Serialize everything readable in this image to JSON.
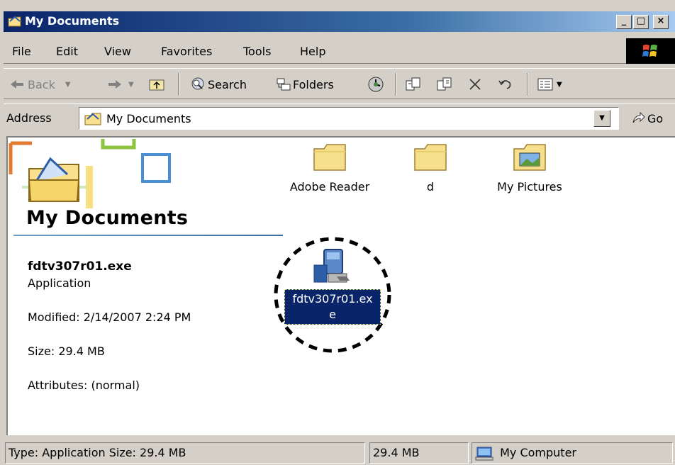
{
  "window": {
    "title": "My Documents",
    "minimize": "_",
    "maximize": "□",
    "close": "×"
  },
  "menu": [
    "File",
    "Edit",
    "View",
    "Favorites",
    "Tools",
    "Help"
  ],
  "toolbar": {
    "back": "Back",
    "search": "Search",
    "folders": "Folders"
  },
  "address": {
    "label": "Address",
    "value": "My Documents",
    "go": "Go"
  },
  "panel": {
    "title": "My Documents",
    "file_name": "fdtv307r01.exe",
    "file_type": "Application",
    "modified": "Modified: 2/14/2007 2:24 PM",
    "size": "Size: 29.4 MB",
    "attributes": "Attributes: (normal)"
  },
  "items": [
    {
      "label": "Adobe Reader",
      "icon": "folder-icon"
    },
    {
      "label": "d",
      "icon": "folder-icon"
    },
    {
      "label": "My Pictures",
      "icon": "pictures-folder-icon"
    }
  ],
  "selected": {
    "label_line1": "fdtv307r01.ex",
    "label_line2": "e",
    "icon": "installer-exe-icon"
  },
  "status": {
    "type_info": "Type: Application Size: 29.4 MB",
    "size": "29.4 MB",
    "zone": "My Computer"
  },
  "colors": {
    "title_start": "#0a246a",
    "title_end": "#a6caf0",
    "selection": "#0a246a",
    "chrome": "#d4d0c8"
  }
}
